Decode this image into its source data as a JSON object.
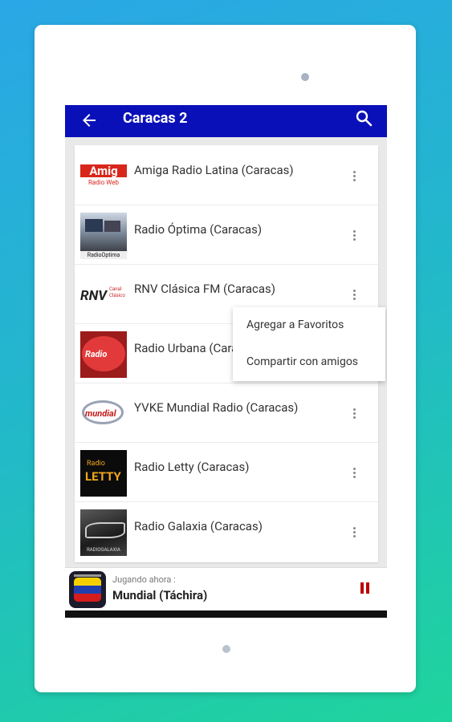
{
  "appbar": {
    "title": "Caracas 2"
  },
  "stations": [
    {
      "name": "Amiga Radio Latina (Caracas)"
    },
    {
      "name": "Radio Óptima (Caracas)"
    },
    {
      "name": "RNV Clásica FM (Caracas)"
    },
    {
      "name": "Radio Urbana (Caracas)"
    },
    {
      "name": "YVKE Mundial Radio (Caracas)"
    },
    {
      "name": "Radio Letty (Caracas)"
    },
    {
      "name": "Radio Galaxia (Caracas)"
    }
  ],
  "context_menu": {
    "add_favorites": "Agregar a Favoritos",
    "share": "Compartir con amigos"
  },
  "player": {
    "label": "Jugando ahora :",
    "station": "Mundial (Táchira)"
  },
  "logo_text": {
    "amiga_line1": "Amig",
    "amiga_line2": "Radio Web",
    "rnv_line1": "RNV",
    "rnv_line2": "Canal",
    "rnv_line3": "Clásico",
    "optima": "RadioOptima",
    "urbana": "Radio",
    "mundial": "mundial",
    "letty_line1": "Radio",
    "letty_line2": "LETTY",
    "galaxia": "RADIOGALAXIA"
  },
  "colors": {
    "appbar": "#0a10b8",
    "pause": "#bb0000"
  }
}
